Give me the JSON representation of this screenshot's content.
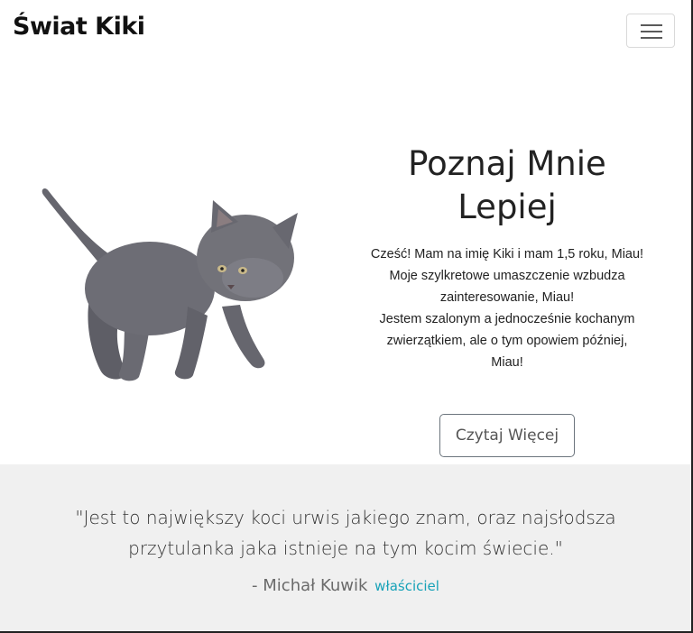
{
  "navbar": {
    "brand": "Świat Kiki",
    "toggler_icon": "hamburger-menu-icon"
  },
  "hero": {
    "image_icon": "kitten-image",
    "title_line1": "Poznaj Mnie",
    "title_line2": "Lepiej",
    "body_lines": [
      "Cześć! Mam na imię Kiki i mam 1,5 roku, Miau!",
      "Moje szylkretowe umaszczenie wzbudza",
      "zainteresowanie, Miau!",
      "Jestem szalonym a jednocześnie kochanym",
      "zwierzątkiem, ale o tym opowiem później,",
      "Miau!"
    ],
    "button_label": "Czytaj Więcej"
  },
  "testimonial": {
    "quote_line1": "\"Jest to największy koci urwis jakiego znam, oraz najsłodsza",
    "quote_line2": "przytulanka jaka istnieje na tym kocim świecie.\"",
    "author": "- Michał Kuwik",
    "role": "właściciel"
  },
  "colors": {
    "testimonial_bg": "#f0f0f0",
    "role_accent": "#17a2b8",
    "cat_fur": "#6b6b72"
  }
}
